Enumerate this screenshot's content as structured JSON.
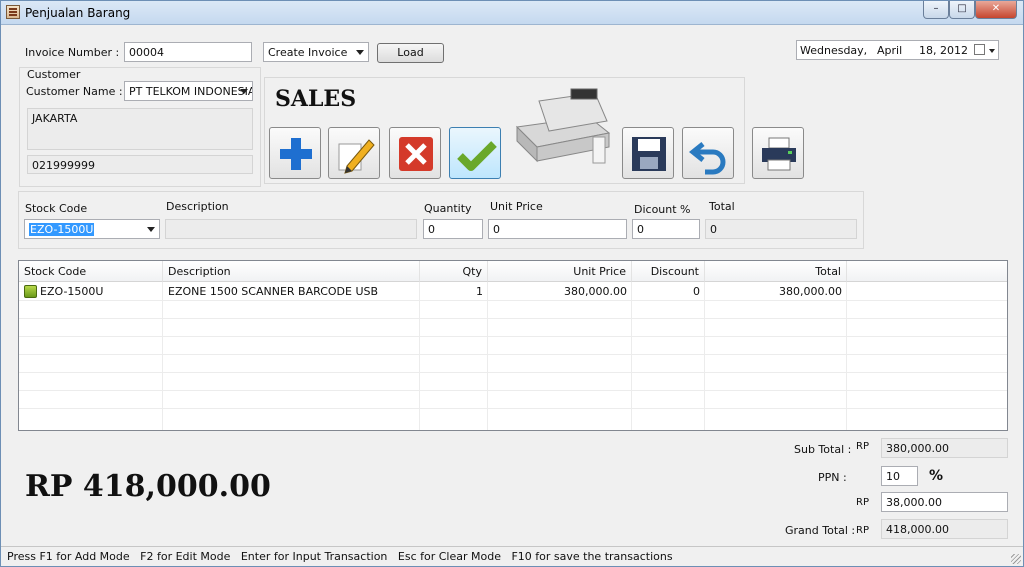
{
  "window": {
    "title": "Penjualan Barang",
    "min_glyph": "–",
    "max_glyph": "□",
    "close_glyph": "✕"
  },
  "invoice": {
    "number_label": "Invoice Number :",
    "number_value": "00004",
    "mode_value": "Create Invoice",
    "load_label": "Load"
  },
  "date": {
    "day": "Wednesday,",
    "month": "April",
    "daynum": "18, 2012"
  },
  "customer": {
    "group_label": "Customer",
    "name_label": "Customer Name :",
    "name_value": "PT TELKOM INDONESIA",
    "address": "JAKARTA",
    "phone": "021999999"
  },
  "toolbar": {
    "title": "SALES",
    "add_icon": "plus-icon",
    "edit_icon": "pencil-icon",
    "delete_icon": "x-icon",
    "confirm_icon": "checkmark-icon",
    "register_icon": "cash-register-icon",
    "save_icon": "floppy-disk-icon",
    "undo_icon": "undo-arrow-icon",
    "print_icon": "printer-icon"
  },
  "entry": {
    "stock_code_label": "Stock Code",
    "stock_code_value": "EZO-1500U",
    "description_label": "Description",
    "description_value": "",
    "quantity_label": "Quantity",
    "quantity_value": "0",
    "unit_price_label": "Unit Price",
    "unit_price_value": "0",
    "discount_label": "Dicount %",
    "discount_value": "0",
    "total_label": "Total",
    "total_value": "0"
  },
  "grid": {
    "headers": {
      "stock_code": "Stock Code",
      "description": "Description",
      "qty": "Qty",
      "unit_price": "Unit Price",
      "discount": "Discount",
      "total": "Total"
    },
    "rows": [
      {
        "stock_code": "EZO-1500U",
        "description": "EZONE 1500 SCANNER BARCODE USB",
        "qty": "1",
        "unit_price": "380,000.00",
        "discount": "0",
        "total": "380,000.00"
      }
    ]
  },
  "summary": {
    "grand_display": "RP 418,000.00",
    "subtotal_label": "Sub Total :",
    "subtotal_cur": "RP",
    "subtotal_value": "380,000.00",
    "ppn_label": "PPN :",
    "ppn_value": "10",
    "ppn_unit": "%",
    "ppn_amount_cur": "RP",
    "ppn_amount_value": "38,000.00",
    "grand_label": "Grand Total :",
    "grand_cur": "RP",
    "grand_value": "418,000.00"
  },
  "status": {
    "text": "Press F1 for Add Mode   F2 for Edit Mode   Enter for Input Transaction   Esc for Clear Mode   F10 for save the transactions"
  }
}
